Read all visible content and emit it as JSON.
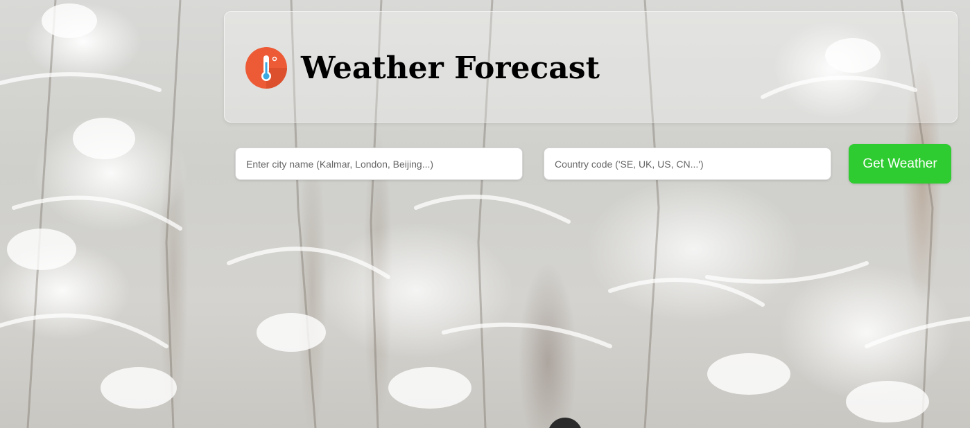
{
  "header": {
    "title": "Weather Forecast",
    "logo_icon": "thermometer-icon",
    "logo_color": "#ed5b36"
  },
  "search": {
    "city_placeholder": "Enter city name (Kalmar, London, Beijing...)",
    "country_placeholder": "Country code ('SE, UK, US, CN...')",
    "button_label": "Get Weather",
    "button_color": "#2ecc30"
  },
  "background": {
    "scene": "snowy-forest"
  }
}
